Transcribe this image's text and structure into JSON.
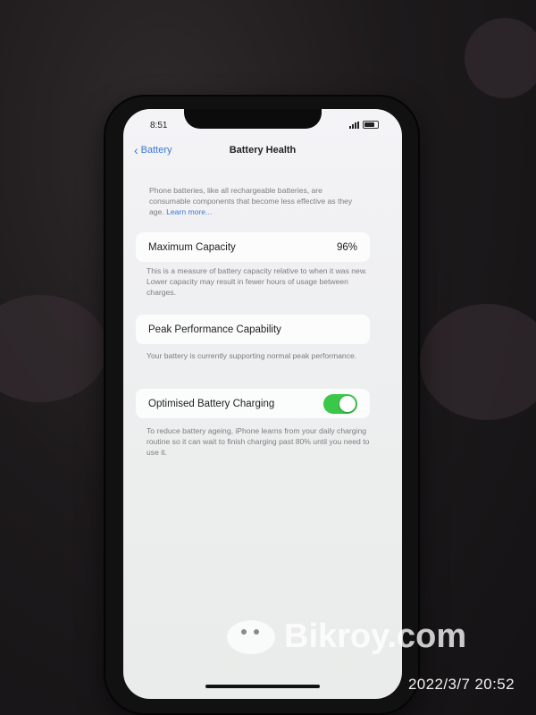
{
  "status": {
    "time": "8:51"
  },
  "nav": {
    "back_label": "Battery",
    "title": "Battery Health"
  },
  "intro": {
    "text": "Phone batteries, like all rechargeable batteries, are consumable components that become less effective as they age.",
    "link": "Learn more..."
  },
  "max_capacity": {
    "label": "Maximum Capacity",
    "value": "96%",
    "description": "This is a measure of battery capacity relative to when it was new. Lower capacity may result in fewer hours of usage between charges."
  },
  "peak_performance": {
    "label": "Peak Performance Capability",
    "description": "Your battery is currently supporting normal peak performance."
  },
  "optimised_charging": {
    "label": "Optimised Battery Charging",
    "enabled": true,
    "description": "To reduce battery ageing, iPhone learns from your daily charging routine so it can wait to finish charging past 80% until you need to use it."
  },
  "watermark": {
    "text": "Bikroy.com"
  },
  "photo_timestamp": "2022/3/7  20:52",
  "colors": {
    "toggle_on": "#3cc64a",
    "link": "#3a78d8"
  }
}
